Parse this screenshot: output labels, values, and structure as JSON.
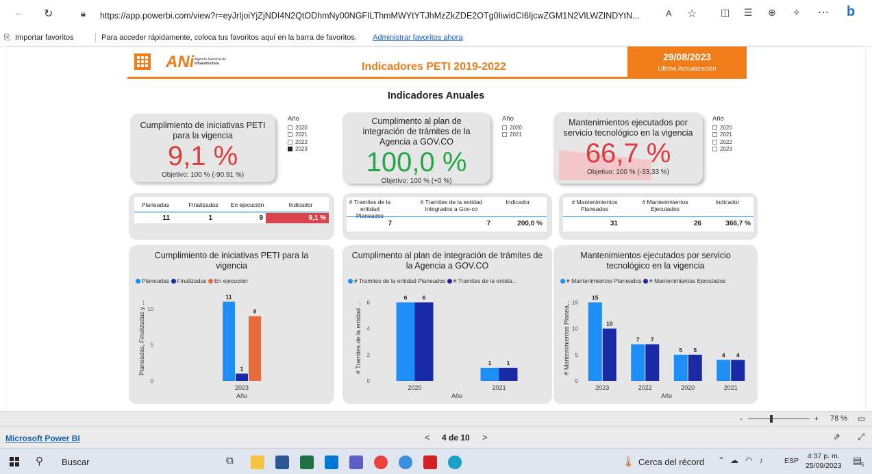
{
  "browser": {
    "url": "https://app.powerbi.com/view?r=eyJrIjoiYjZjNDI4N2QtODhmNy00NGFILThmMWYtYTJhMzZkZDE2OTg0IiwidCI6IjcwZGM1N2VlLWZINDYtN...",
    "favorites": {
      "import_label": "Importar favoritos",
      "hint": "Para acceder rápidamente, coloca tus favoritos aquí en la barra de favoritos.",
      "manage_link": "Administrar favoritos ahora"
    }
  },
  "header": {
    "logo_text": "ANi",
    "logo_sub1": "Agencia Nacional de",
    "logo_sub2": "Infraestructura",
    "title": "Indicadores PETI 2019-2022",
    "date": "29/08/2023",
    "date_caption": "Ultima Actualización"
  },
  "section_title": "Indicadores Anuales",
  "kpis": [
    {
      "title": "Cumplimiento de iniciativas PETI para la vigencia",
      "value": "9,1 %",
      "objective": "Objetivo: 100 % (-90.91 %)",
      "color": "#e03c3c",
      "fill": 0.091
    },
    {
      "title": "Cumplimento al plan de integración de trámites de la Agencia a GOV.CO",
      "value": "100,0 %",
      "objective": "Objetivo: 100 % (+0 %)",
      "color": "#22a845",
      "fill": 1.0
    },
    {
      "title": "Mantenimientos ejecutados por servicio tecnológico en la vigencia",
      "value": "66,7 %",
      "objective": "Objetivo: 100 % (-33.33 %)",
      "color": "#e03c3c",
      "fill": 0.667
    }
  ],
  "slicers": [
    {
      "header": "Año",
      "items": [
        {
          "label": "2020",
          "on": false
        },
        {
          "label": "2021",
          "on": false
        },
        {
          "label": "2022",
          "on": false
        },
        {
          "label": "2023",
          "on": true
        }
      ]
    },
    {
      "header": "Año",
      "items": [
        {
          "label": "2020",
          "on": false
        },
        {
          "label": "2021",
          "on": false
        }
      ]
    },
    {
      "header": "Año",
      "items": [
        {
          "label": "2020",
          "on": false
        },
        {
          "label": "2021",
          "on": false
        },
        {
          "label": "2022",
          "on": false
        },
        {
          "label": "2023",
          "on": false
        }
      ]
    }
  ],
  "tables": [
    {
      "headers": [
        "Planeadas",
        "Finalizadas",
        "En ejecución",
        "Indicador"
      ],
      "values": [
        "11",
        "1",
        "9",
        "9,1 %"
      ]
    },
    {
      "headers": [
        "# Tramites de la entidad Planeados",
        "# Tramites de la entidad Integrados a Gov-co",
        "Indicador"
      ],
      "values": [
        "7",
        "7",
        "200,0 %"
      ]
    },
    {
      "headers": [
        "# Mantenimientos Planeados",
        "# Mantenimientos Ejecutados",
        "Indicador"
      ],
      "values": [
        "31",
        "26",
        "366,7 %"
      ]
    }
  ],
  "colors": {
    "orange": "#f07c1a",
    "light_blue": "#1e8ef7",
    "dark_blue": "#1a2aa6",
    "chart_orange": "#e86c3a",
    "red_cell": "#d9434e"
  },
  "chart_data": [
    {
      "type": "bar",
      "title": "Cumplimiento de iniciativas PETI para la vigencia",
      "xlabel": "Año",
      "ylabel": "Planeadas, Finalizadas y ...",
      "categories": [
        "2023"
      ],
      "series": [
        {
          "name": "Planeadas",
          "values": [
            11
          ],
          "color": "#1e8ef7"
        },
        {
          "name": "Finalizadas",
          "values": [
            1
          ],
          "color": "#1a2aa6"
        },
        {
          "name": "En ejecución",
          "values": [
            9
          ],
          "color": "#e86c3a"
        }
      ],
      "ylim": [
        0,
        12
      ],
      "yticks": [
        0,
        5,
        10
      ]
    },
    {
      "type": "bar",
      "title": "Cumplimento al plan de integración de trámites de la Agencia a GOV.CO",
      "xlabel": "Año",
      "ylabel": "# Tramites de la entidad ...",
      "categories": [
        "2020",
        "2021"
      ],
      "series": [
        {
          "name": "# Tramites de la entidad Planeados",
          "values": [
            6,
            1
          ],
          "color": "#1e8ef7"
        },
        {
          "name": "# Tramites de la entida...",
          "values": [
            6,
            1
          ],
          "color": "#1a2aa6"
        }
      ],
      "ylim": [
        0,
        6.6
      ],
      "yticks": [
        0,
        2,
        4,
        6
      ]
    },
    {
      "type": "bar",
      "title": "Mantenimientos ejecutados por servicio tecnológico en la vigencia",
      "xlabel": "Año",
      "ylabel": "# Mantenimientos Planea...",
      "categories": [
        "2023",
        "2022",
        "2020",
        "2021"
      ],
      "series": [
        {
          "name": "# Mantenimientos Planeados",
          "values": [
            15,
            7,
            5,
            4
          ],
          "color": "#1e8ef7"
        },
        {
          "name": "# Mantenimientos Ejecutados",
          "values": [
            10,
            7,
            5,
            4
          ],
          "color": "#1a2aa6"
        }
      ],
      "ylim": [
        0,
        16.5
      ],
      "yticks": [
        0,
        5,
        10,
        15
      ]
    }
  ],
  "zoom": {
    "level": "78 %"
  },
  "footer": {
    "brand": "Microsoft Power BI",
    "page": "4 de 10",
    "prev": "<",
    "next": ">"
  },
  "taskbar": {
    "search": "Buscar",
    "weather": "Cerca del récord",
    "lang": "ESP",
    "time": "4:37 p. m.",
    "date": "25/09/2023",
    "notif": "5"
  }
}
